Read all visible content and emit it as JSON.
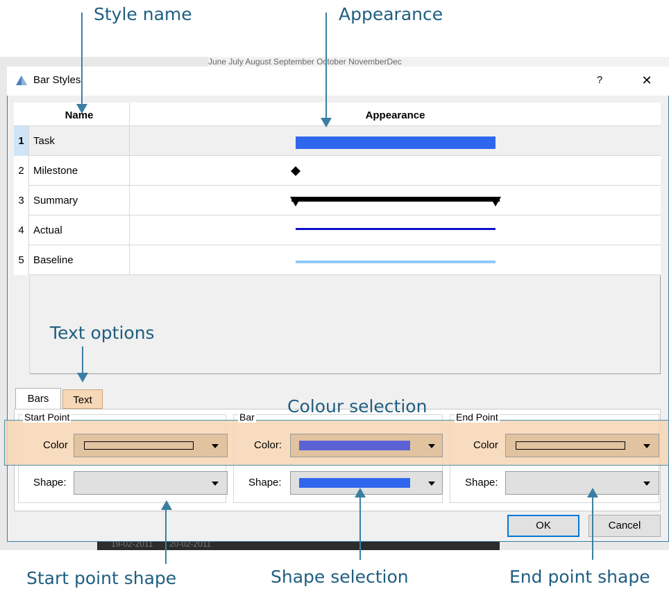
{
  "annotations": {
    "style_name": "Style name",
    "appearance": "Appearance",
    "text_options": "Text options",
    "colour_selection": "Colour selection",
    "start_point_shape": "Start point shape",
    "shape_selection": "Shape selection",
    "end_point_shape": "End point shape"
  },
  "background": {
    "months": "June        July        August   September  October  NovemberDec",
    "footer_dates": [
      "19-02-2011",
      "20-02-2011"
    ]
  },
  "dialog": {
    "title": "Bar Styles",
    "help_label": "?",
    "close_label": "✕",
    "icon": "app-triangle-icon"
  },
  "grid": {
    "columns": [
      "Name",
      "Appearance"
    ],
    "rows": [
      {
        "num": "1",
        "name": "Task",
        "appearance": "task-bar",
        "color": "#2f66ee"
      },
      {
        "num": "2",
        "name": "Milestone",
        "appearance": "diamond",
        "color": "#000000"
      },
      {
        "num": "3",
        "name": "Summary",
        "appearance": "summary-bar",
        "color": "#000000"
      },
      {
        "num": "4",
        "name": "Actual",
        "appearance": "thin-line",
        "color": "#1010cc"
      },
      {
        "num": "5",
        "name": "Baseline",
        "appearance": "light-line",
        "color": "#8fc8f6"
      }
    ]
  },
  "tabs": [
    "Bars",
    "Text"
  ],
  "groups": {
    "start_point": {
      "label": "Start Point",
      "color_label": "Color",
      "shape_label": "Shape:",
      "color_value": "#e1c3a0"
    },
    "bar": {
      "label": "Bar",
      "color_label": "Color:",
      "shape_label": "Shape:",
      "color_value": "#5b63d4",
      "shape_color": "#2f66ee"
    },
    "end_point": {
      "label": "End Point",
      "color_label": "Color",
      "shape_label": "Shape:",
      "color_value": "#e1c3a0"
    }
  },
  "buttons": {
    "ok": "OK",
    "cancel": "Cancel"
  },
  "colors": {
    "annotation": "#1f5e80",
    "highlight": "#f6d6b4",
    "selection": "#cfe4f7"
  }
}
